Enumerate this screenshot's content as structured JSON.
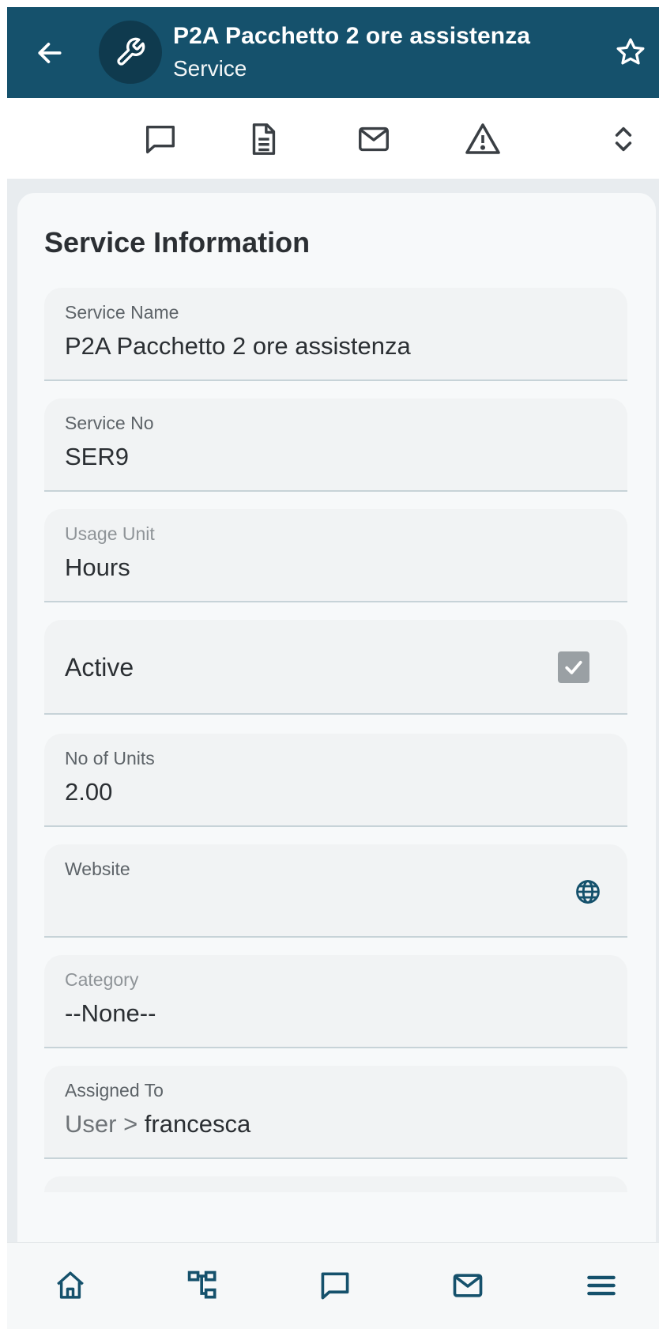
{
  "header": {
    "title": "P2A Pacchetto 2 ore assistenza",
    "subtitle": "Service",
    "back_icon": "arrow-left-icon",
    "module_icon": "wrench-icon",
    "favorite_icon": "star-outline-icon",
    "background_color": "#15516c"
  },
  "toolbar": {
    "items": [
      {
        "icon": "comment-icon"
      },
      {
        "icon": "document-icon"
      },
      {
        "icon": "email-icon"
      },
      {
        "icon": "warning-icon"
      },
      {
        "icon": "expand-collapse-icon"
      }
    ]
  },
  "section": {
    "title": "Service Information"
  },
  "fields": {
    "service_name": {
      "label": "Service Name",
      "value": "P2A Pacchetto 2 ore assistenza"
    },
    "service_no": {
      "label": "Service No",
      "value": "SER9"
    },
    "usage_unit": {
      "label": "Usage Unit",
      "value": "Hours"
    },
    "active": {
      "label": "Active",
      "checked": true
    },
    "no_of_units": {
      "label": "No of Units",
      "value": "2.00"
    },
    "website": {
      "label": "Website",
      "value": ""
    },
    "category": {
      "label": "Category",
      "value": "--None--"
    },
    "assigned_to": {
      "label": "Assigned To",
      "prefix": "User >",
      "value": "francesca"
    }
  },
  "bottom_nav": {
    "items": [
      {
        "icon": "home-icon"
      },
      {
        "icon": "hierarchy-icon"
      },
      {
        "icon": "comment-icon"
      },
      {
        "icon": "email-icon"
      },
      {
        "icon": "menu-icon"
      }
    ]
  }
}
